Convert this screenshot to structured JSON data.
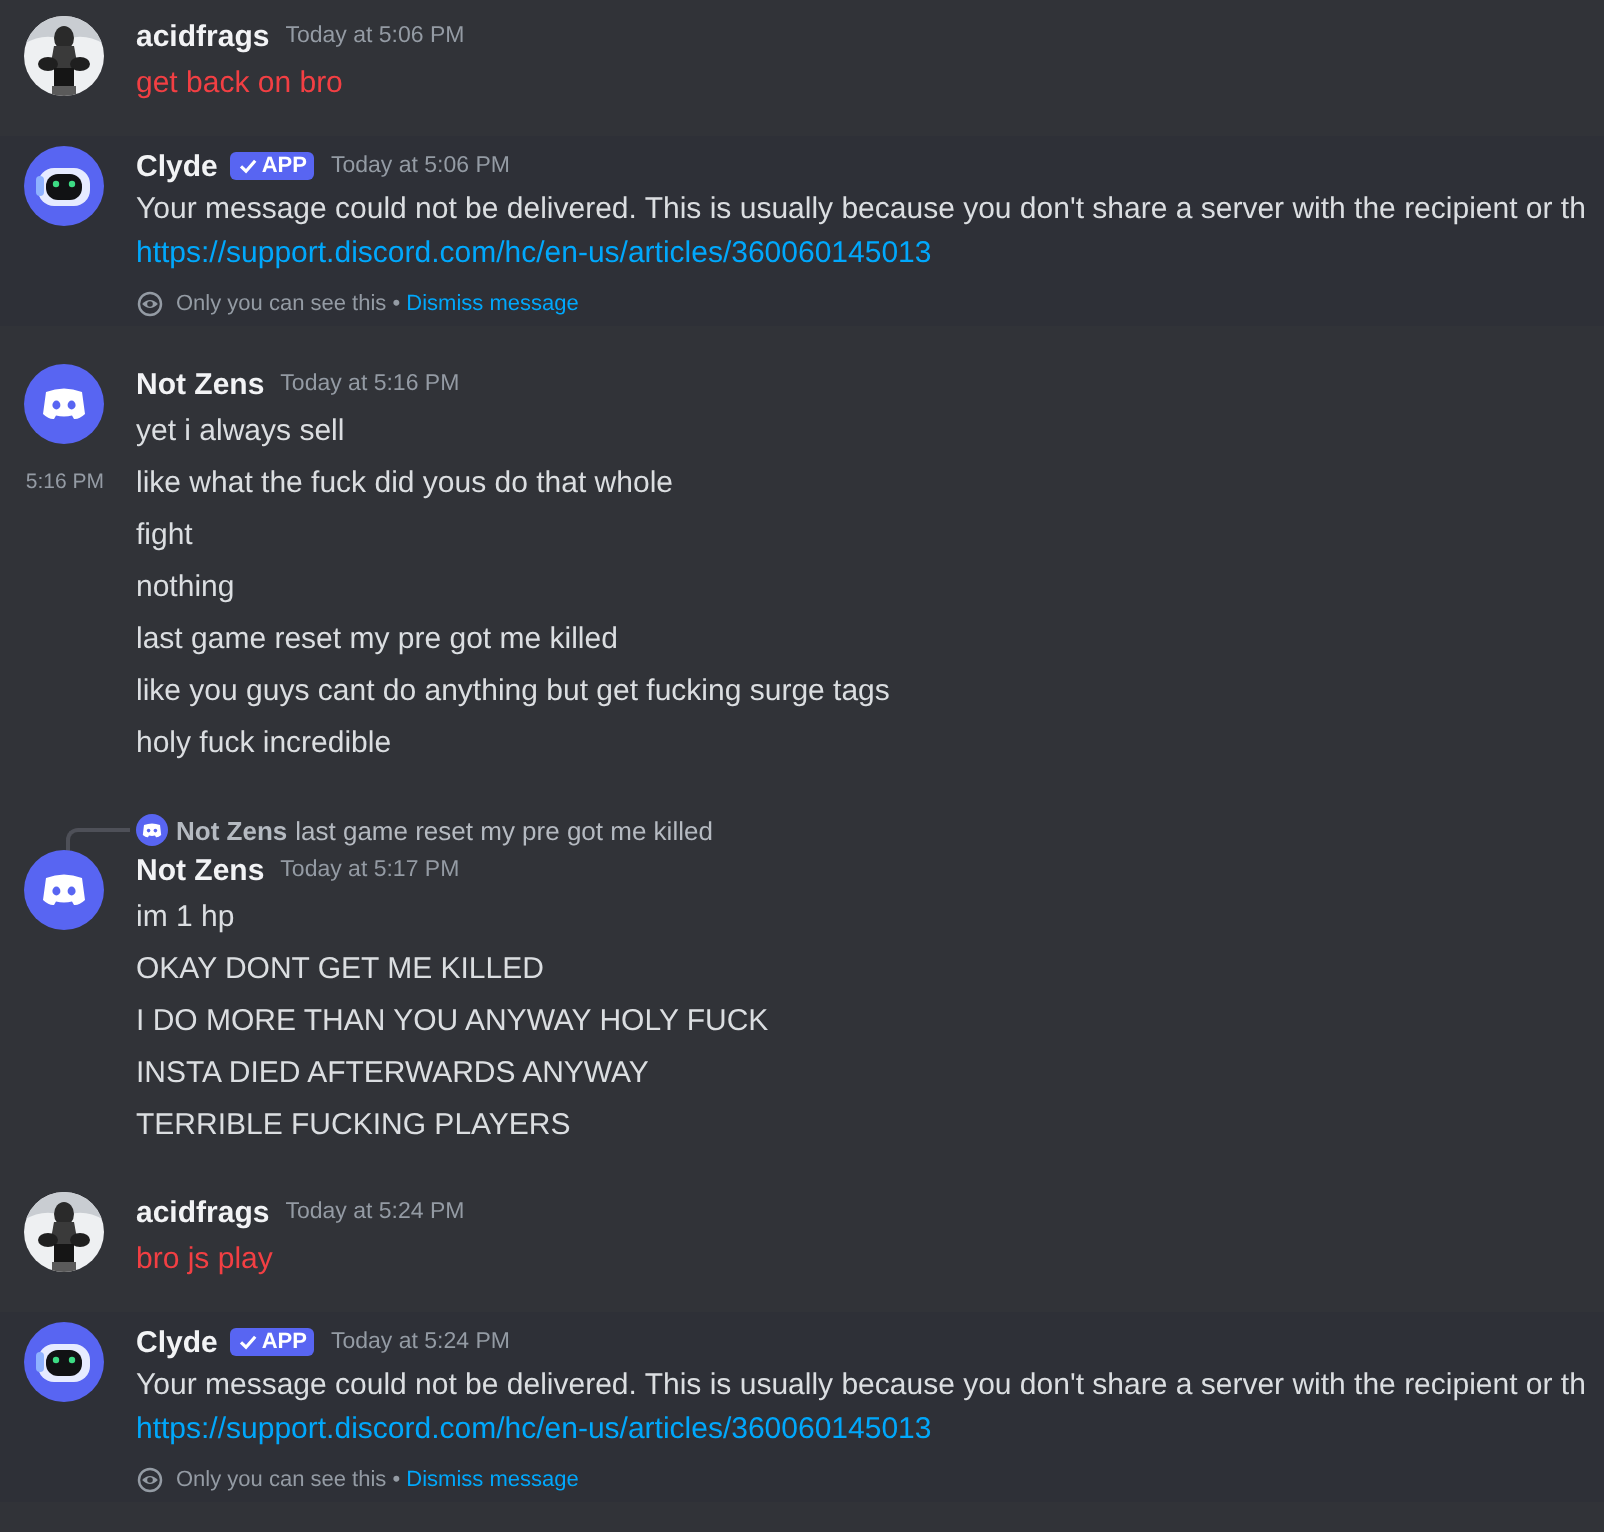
{
  "messages": [
    {
      "author": "acidfrags",
      "time": "Today at 5:06 PM",
      "lines": [
        {
          "text": "get back on bro",
          "failed": true
        }
      ]
    },
    {
      "author": "Clyde",
      "avatar": {
        "kind": "clyde"
      },
      "badge": "APP",
      "time": "Today at 5:06 PM",
      "lines": [
        {
          "text": "Your message could not be delivered. This is usually because you don't share a server with the recipient or th",
          "failed": false
        }
      ],
      "link": "https://support.discord.com/hc/en-us/articles/360060145013",
      "ephemeral": {
        "note": "Only you can see this",
        "separator": "•",
        "action": "Dismiss message"
      }
    },
    {
      "author": "Not Zens",
      "avatar": {
        "kind": "default"
      },
      "time": "Today at 5:16 PM",
      "lines": [
        {
          "text": "yet i always sell",
          "failed": false
        },
        {
          "text": "like what the fuck did yous do that whole",
          "failed": false,
          "side_time": "5:16 PM"
        },
        {
          "text": "fight",
          "failed": false
        },
        {
          "text": "nothing",
          "failed": false
        },
        {
          "text": "last game reset my pre got me killed",
          "failed": false
        },
        {
          "text": "like you guys cant do anything but get fucking surge tags",
          "failed": false
        },
        {
          "text": "holy fuck incredible",
          "failed": false
        }
      ]
    },
    {
      "author": "Not Zens",
      "avatar": {
        "kind": "default"
      },
      "time": "Today at 5:17 PM",
      "reply": {
        "author": "Not Zens",
        "text": "last game reset my pre got me killed"
      },
      "lines": [
        {
          "text": "im 1 hp",
          "failed": false
        },
        {
          "text": "OKAY DONT GET ME KILLED",
          "failed": false
        },
        {
          "text": "I DO MORE THAN YOU ANYWAY HOLY FUCK",
          "failed": false
        },
        {
          "text": "INSTA DIED AFTERWARDS ANYWAY",
          "failed": false
        },
        {
          "text": "TERRIBLE FUCKING PLAYERS",
          "failed": false
        }
      ]
    },
    {
      "author": "acidfrags",
      "time": "Today at 5:24 PM",
      "lines": [
        {
          "text": "bro js play",
          "failed": true
        }
      ]
    },
    {
      "author": "Clyde",
      "avatar": {
        "kind": "clyde"
      },
      "badge": "APP",
      "time": "Today at 5:24 PM",
      "lines": [
        {
          "text": "Your message could not be delivered. This is usually because you don't share a server with the recipient or th",
          "failed": false
        }
      ],
      "link": "https://support.discord.com/hc/en-us/articles/360060145013",
      "ephemeral": {
        "note": "Only you can see this",
        "separator": "•",
        "action": "Dismiss message"
      }
    }
  ]
}
